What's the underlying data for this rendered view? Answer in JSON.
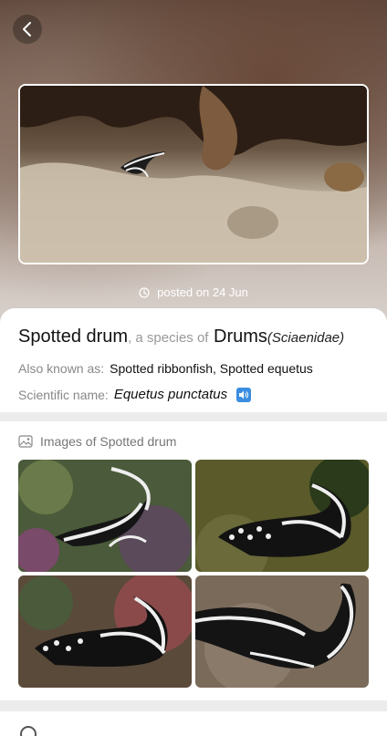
{
  "header": {
    "back_icon": "chevron-left-icon"
  },
  "hero": {
    "posted_text": "posted on 24 Jun",
    "posted_icon": "clock-icon"
  },
  "species": {
    "common_name": "Spotted drum",
    "connector": ", a species of",
    "family": "Drums",
    "family_latin": "(Sciaenidae)",
    "aka_label": "Also known as:",
    "aka_value": "Spotted ribbonfish, Spotted equetus",
    "sci_label": "Scientific name:",
    "sci_value": "Equetus punctatus",
    "audio_icon": "speaker-icon"
  },
  "gallery": {
    "icon": "image-gallery-icon",
    "title": "Images of Spotted drum"
  },
  "colors": {
    "accent": "#3b8de0"
  }
}
